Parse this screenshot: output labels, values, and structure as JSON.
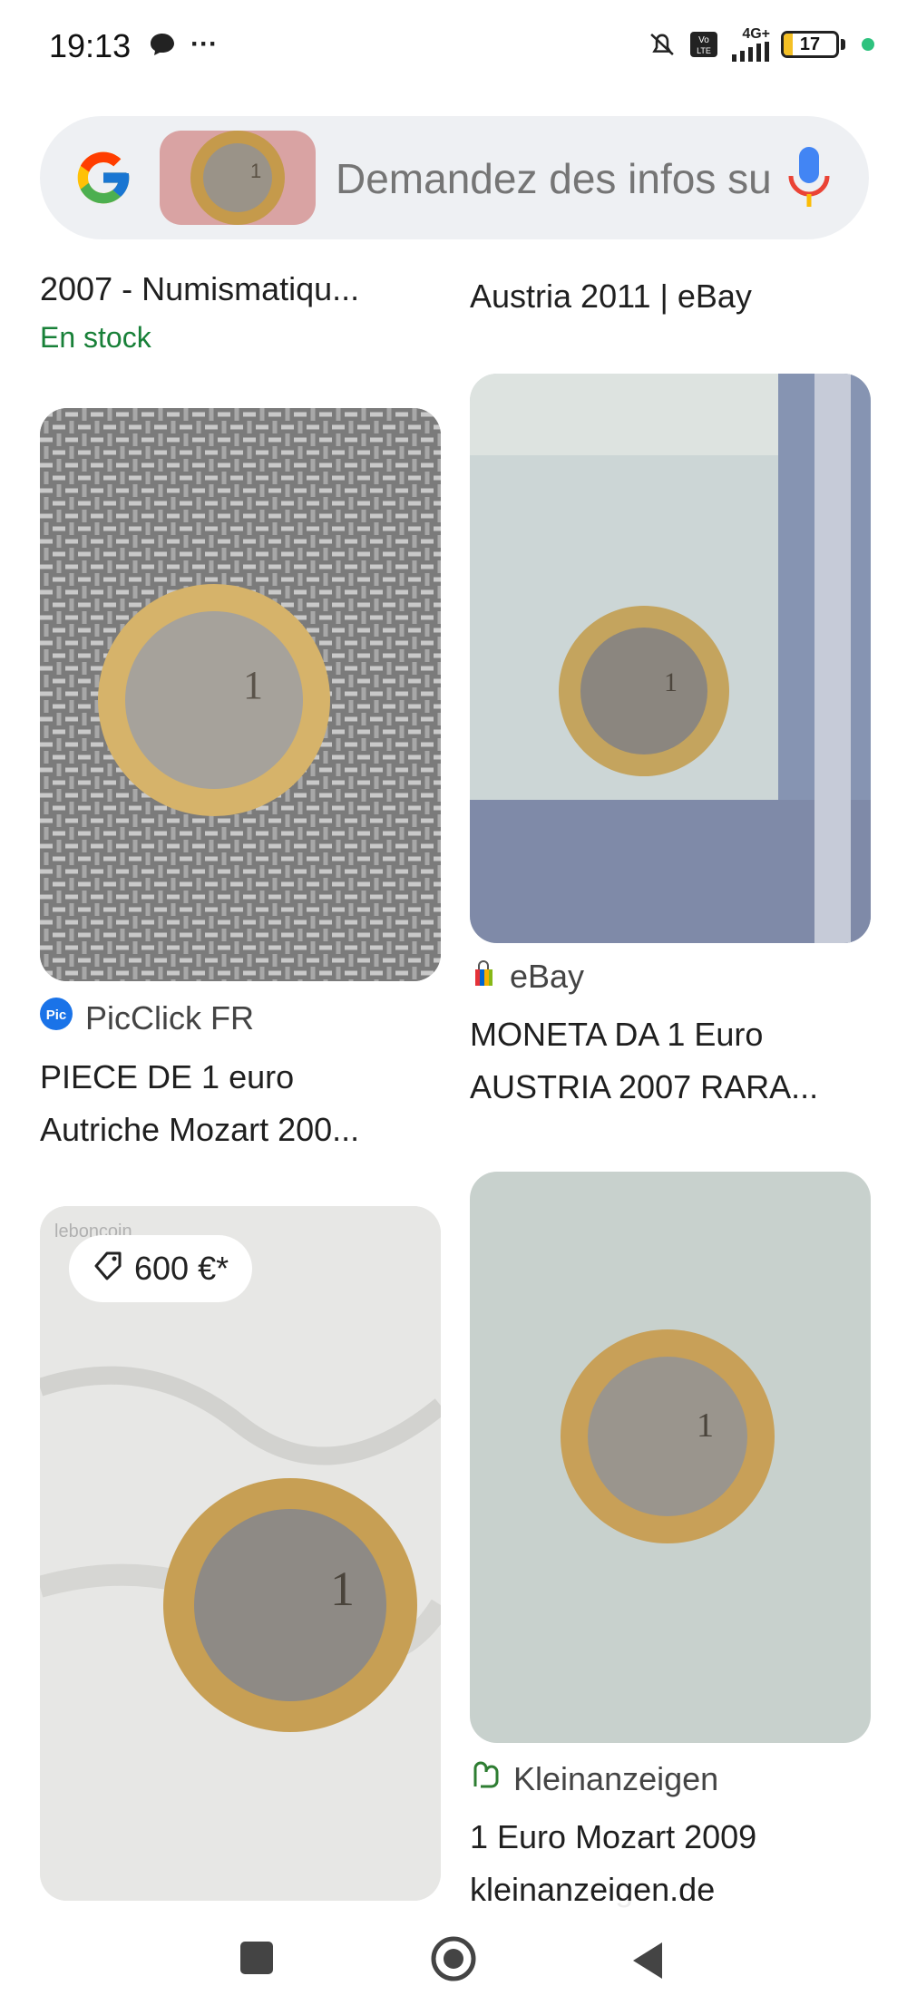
{
  "status_bar": {
    "time": "19:13",
    "dots": "···",
    "network_label": "4G+",
    "battery_level": "17",
    "battery_fraction": 0.17,
    "icons": [
      "chat-bubble-icon",
      "mute-icon",
      "volte-icon",
      "signal-icon",
      "battery-icon"
    ]
  },
  "search": {
    "placeholder": "Demandez des infos su",
    "logo": "google-g-icon",
    "mic": "microphone-icon"
  },
  "top_row": {
    "left_title": "2007 - Numismatiqu...",
    "left_stock": "En stock",
    "right_title": "Austria 2011 | eBay"
  },
  "results": [
    {
      "source": "PicClick FR",
      "title_line1": "PIECE DE 1 euro",
      "title_line2": "Autriche Mozart 200..."
    },
    {
      "source": "eBay",
      "title_line1": "MONETA DA 1 Euro",
      "title_line2": "AUSTRIA 2007 RARA..."
    },
    {
      "price": "600 €*",
      "watermark": "leboncoin"
    },
    {
      "source": "Kleinanzeigen",
      "title_line1": "1 Euro Mozart 2009",
      "title_line2": "kleinanzeigen.de"
    }
  ],
  "colors": {
    "accent_green": "#188038",
    "search_bg": "#eef0f3",
    "battery_yellow": "#f4c025"
  }
}
